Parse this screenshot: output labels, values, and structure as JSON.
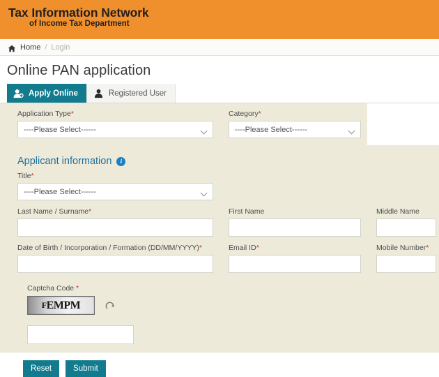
{
  "header": {
    "logo_line1": "Tax Information Network",
    "logo_line2": "of Income Tax Department",
    "banner_color": "#f0902d"
  },
  "breadcrumb": {
    "home_label": "Home",
    "separator": "/",
    "current_label": "Login",
    "home_icon": "home-icon"
  },
  "page_title": "Online PAN application",
  "tabs": [
    {
      "label": "Apply Online",
      "icon": "user-add-icon",
      "active": true
    },
    {
      "label": "Registered User",
      "icon": "user-check-icon",
      "active": false
    }
  ],
  "form": {
    "application_type": {
      "label": "Application Type",
      "required": "*",
      "value": "----Please Select------"
    },
    "category": {
      "label": "Category",
      "required": "*",
      "value": "----Please Select------"
    },
    "section_heading": "Applicant information",
    "section_info_icon": "info-icon",
    "title_field": {
      "label": "Title",
      "required": "*",
      "value": "----Please Select------"
    },
    "last_name": {
      "label": "Last Name / Surname",
      "required": "*",
      "value": ""
    },
    "first_name": {
      "label": "First Name",
      "required": "",
      "value": ""
    },
    "middle_name": {
      "label": "Middle Name",
      "required": "",
      "value": ""
    },
    "date_of_birth": {
      "label": "Date of Birth / Incorporation / Formation (DD/MM/YYYY)",
      "required": "*",
      "value": ""
    },
    "email": {
      "label": "Email ID",
      "required": "*",
      "value": ""
    },
    "mobile": {
      "label": "Mobile Number",
      "required": "*",
      "value": ""
    },
    "captcha": {
      "label": "Captcha Code ",
      "required": "*",
      "image_text_small": "F",
      "image_text_large": "EMPM",
      "refresh_icon": "refresh-icon",
      "input_value": ""
    }
  },
  "buttons": {
    "reset": "Reset",
    "submit": "Submit",
    "color": "#127b8e"
  },
  "colors": {
    "panel_bg": "#edeada",
    "accent": "#127b8e",
    "link_blue": "#1f6f9b",
    "required_red": "#b03a2e"
  }
}
